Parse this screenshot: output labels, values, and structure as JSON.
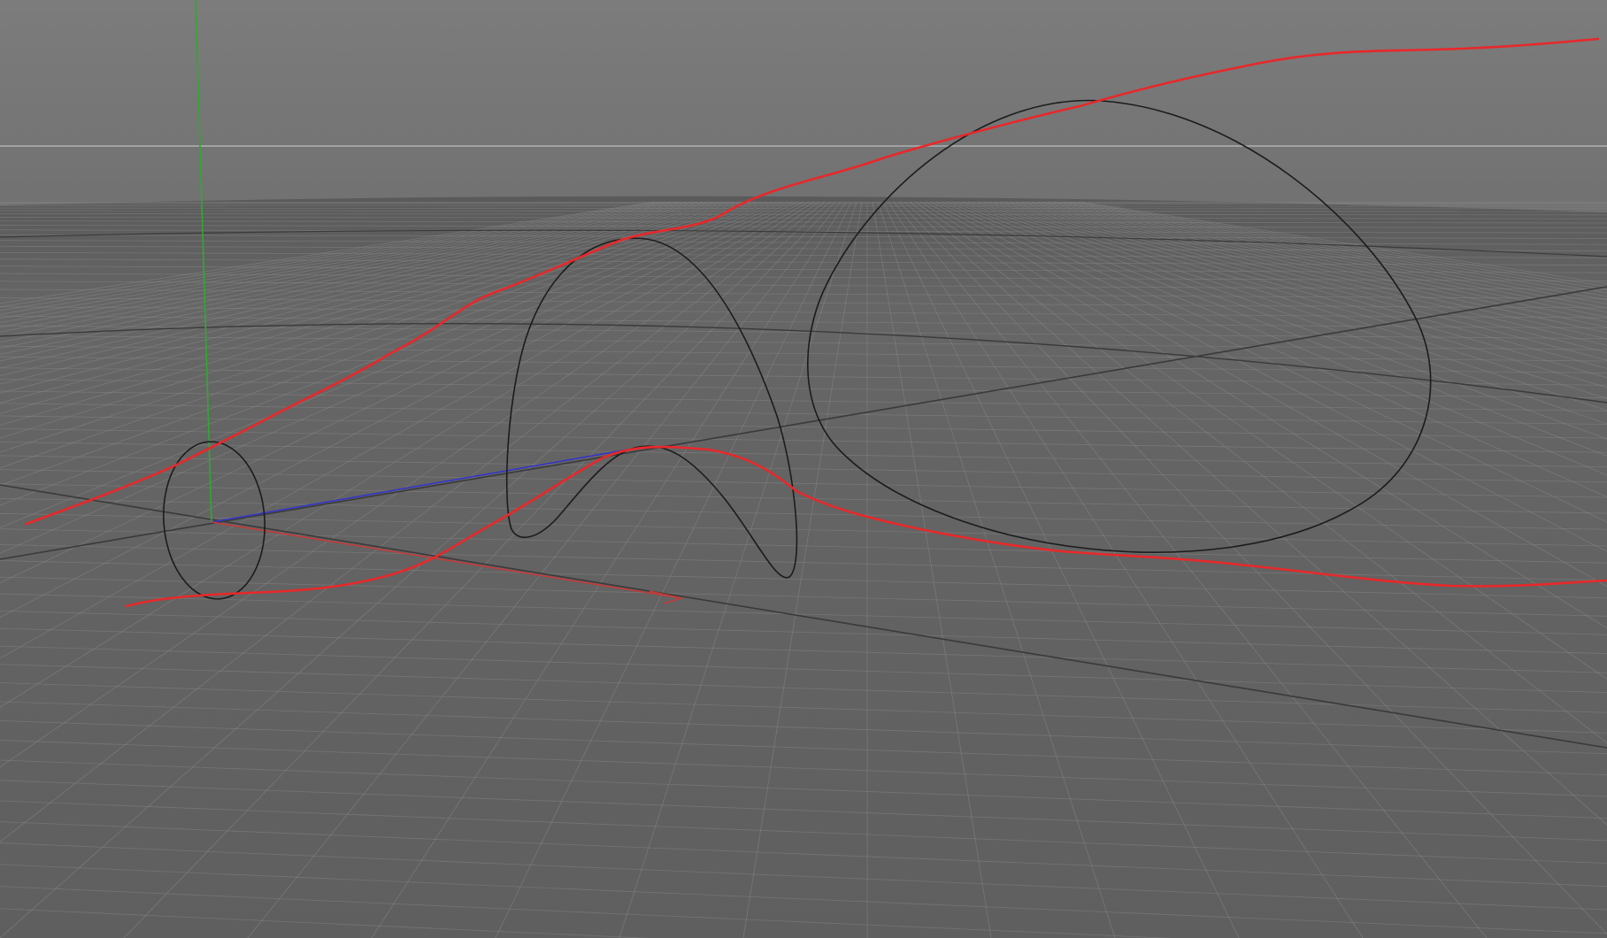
{
  "viewport": {
    "name": "3d-viewport",
    "colors": {
      "sky_top": "#7a7a7a",
      "sky_bottom": "#6f6f6f",
      "ground_far": "#646464",
      "ground_near": "#5e5e5e",
      "grid_line": "#8a8a8a",
      "grid_major": "#3c3c3c",
      "horizon_line": "#b4b4b4",
      "curve_stroke": "#1c1c1c",
      "sketch_stroke": "#e8282a",
      "axis_x": "#c43a3a",
      "axis_y": "#2eaa2e",
      "axis_z": "#3a3acc"
    },
    "icons": {
      "gizmo_x": "axis-x-arrow-icon",
      "gizmo_y": "axis-y-line-icon",
      "gizmo_z": "axis-z-line-icon"
    },
    "objects": [
      {
        "name": "profile-curve-small-ellipse",
        "kind": "nurbs-circle"
      },
      {
        "name": "profile-curve-arch",
        "kind": "nurbs-curve"
      },
      {
        "name": "profile-curve-large-loop",
        "kind": "nurbs-circle"
      },
      {
        "name": "sketch-curve-upper",
        "kind": "grease-pencil-stroke"
      },
      {
        "name": "sketch-curve-lower",
        "kind": "grease-pencil-stroke"
      }
    ]
  }
}
